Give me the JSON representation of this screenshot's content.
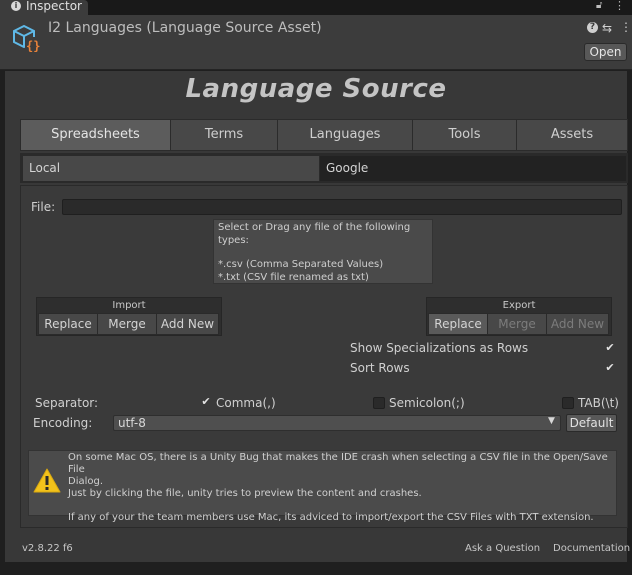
{
  "window": {
    "tab_label": "Inspector",
    "asset_title": "I2 Languages (Language Source Asset)",
    "open_label": "Open"
  },
  "main": {
    "title": "Language Source",
    "tabs": [
      "Spreadsheets",
      "Terms",
      "Languages",
      "Tools",
      "Assets"
    ],
    "selected_tab": "Spreadsheets",
    "subtabs": [
      "Local",
      "Google"
    ],
    "selected_subtab": "Local"
  },
  "file": {
    "label": "File:",
    "value": "",
    "drop_text": {
      "line1": "Select or Drag any file of the following types:",
      "line2": "*.csv  (Comma Separated Values)",
      "line3": "*.txt  (CSV file renamed as txt)"
    }
  },
  "import_group": {
    "title": "Import",
    "buttons": [
      "Replace",
      "Merge",
      "Add New"
    ]
  },
  "export_group": {
    "title": "Export",
    "buttons": [
      "Replace",
      "Merge",
      "Add New"
    ],
    "enabled": [
      true,
      false,
      false
    ]
  },
  "options": {
    "show_specializations": {
      "label": "Show Specializations as Rows",
      "checked": true
    },
    "sort_rows": {
      "label": "Sort Rows",
      "checked": true
    }
  },
  "separator": {
    "label": "Separator:",
    "comma": {
      "label": "Comma(,)",
      "checked": true
    },
    "semicolon": {
      "label": "Semicolon(;)",
      "checked": false
    },
    "tab": {
      "label": "TAB(\\t)",
      "checked": false
    }
  },
  "encoding": {
    "label": "Encoding:",
    "value": "utf-8",
    "default_label": "Default"
  },
  "warning": {
    "line1": "On some Mac OS, there is a Unity Bug that makes the IDE crash when selecting a CSV file in the Open/Save File",
    "line2": "Dialog.",
    "line3": "Just by clicking the file, unity tries to preview the content and crashes.",
    "line4": "If any of your the team members use Mac, its adviced to import/export the CSV Files with TXT extension."
  },
  "footer": {
    "version": "v2.8.22 f6",
    "ask_label": "Ask a Question",
    "doc_label": "Documentation"
  },
  "icons": {
    "info": "info-icon",
    "lock": "lock-icon",
    "menu": "kebab-menu-icon",
    "help": "help-icon",
    "settings": "sliders-icon",
    "asset": "cube-script-icon",
    "warning": "warning-triangle-icon",
    "check": "checkmark-icon",
    "dropdown": "dropdown-arrow-icon"
  },
  "colors": {
    "accent_asset_blue": "#5fb8e6",
    "accent_asset_orange": "#e8823a",
    "warning_yellow": "#f2c21b"
  }
}
